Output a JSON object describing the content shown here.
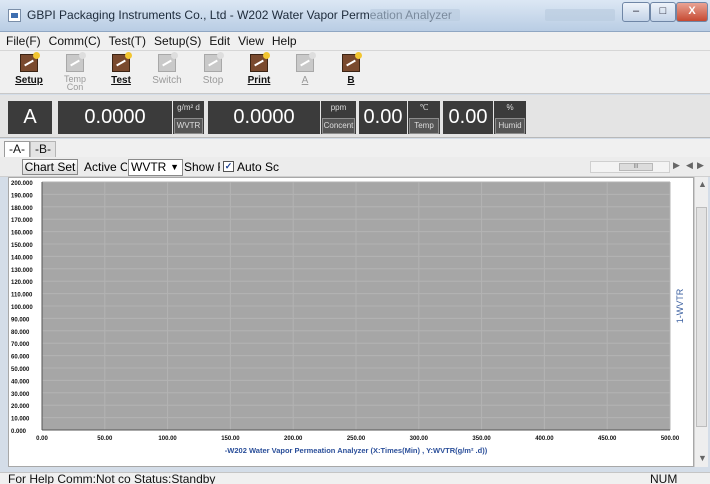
{
  "window": {
    "title": "GBPI Packaging Instruments Co., Ltd - W202 Water Vapor Permeation Analyzer",
    "minimize_label": "–",
    "maximize_label": "□",
    "close_label": "X"
  },
  "menu": [
    "File(F)",
    "Comm(C)",
    "Test(T)",
    "Setup(S)",
    "Edit",
    "View",
    "Help"
  ],
  "toolbar": [
    {
      "label": "Setup",
      "enabled": true
    },
    {
      "label": "Temp Con",
      "enabled": false
    },
    {
      "label": "Test",
      "enabled": true
    },
    {
      "label": "Switch",
      "enabled": false
    },
    {
      "label": "Stop",
      "enabled": false
    },
    {
      "label": "Print",
      "enabled": true
    },
    {
      "label": "A",
      "enabled": false
    },
    {
      "label": "B",
      "enabled": true
    }
  ],
  "readouts": {
    "channel": "A",
    "wvtr_value": "0.0000",
    "wvtr_unit": "g/m² d",
    "wvtr_label": "WVTR",
    "concent_value": "0.0000",
    "concent_unit": "ppm",
    "concent_label": "Concent",
    "temp_value": "0.00",
    "temp_unit": "℃",
    "temp_label": "Temp",
    "humid_value": "0.00",
    "humid_unit": "%",
    "humid_label": "Humid"
  },
  "tabs": [
    {
      "label": "-A-",
      "active": true
    },
    {
      "label": "-B-",
      "active": false
    }
  ],
  "chart_controls": {
    "chart_set_label": "Chart Set",
    "active_label": "Active Cl",
    "active_value": "WVTR",
    "show_full_label": "Show Ful",
    "auto_scale_label": "Auto Sc",
    "auto_scale_checked": true,
    "scroll_thumb_label": "III"
  },
  "chart_data": {
    "type": "line",
    "title": "-W202 Water Vapor Permeation Analyzer (X:Times(Min) , Y:WVTR(g/m² .d))",
    "xlabel": "",
    "ylabel": "",
    "series": [
      {
        "name": "1-WVTR",
        "x": [],
        "y": []
      }
    ],
    "x_ticks": [
      0,
      50,
      100,
      150,
      200,
      250,
      300,
      350,
      400,
      450,
      500
    ],
    "y_ticks": [
      0,
      10,
      20,
      30,
      40,
      50,
      60,
      70,
      80,
      90,
      100,
      110,
      120,
      130,
      140,
      150,
      160,
      170,
      180,
      190,
      200
    ],
    "xlim": [
      0,
      500
    ],
    "ylim": [
      0,
      200
    ],
    "tick_decimals": 3,
    "grid": true,
    "plot_background": "#a6a6a6",
    "grid_color": "#b3b3b3",
    "series_label_color": "#3a5fa0",
    "title_color": "#2b4f9a",
    "legend_position": "right"
  },
  "status": {
    "text": "For Help Comm:Not co Status:Standby",
    "num": "NUM"
  }
}
